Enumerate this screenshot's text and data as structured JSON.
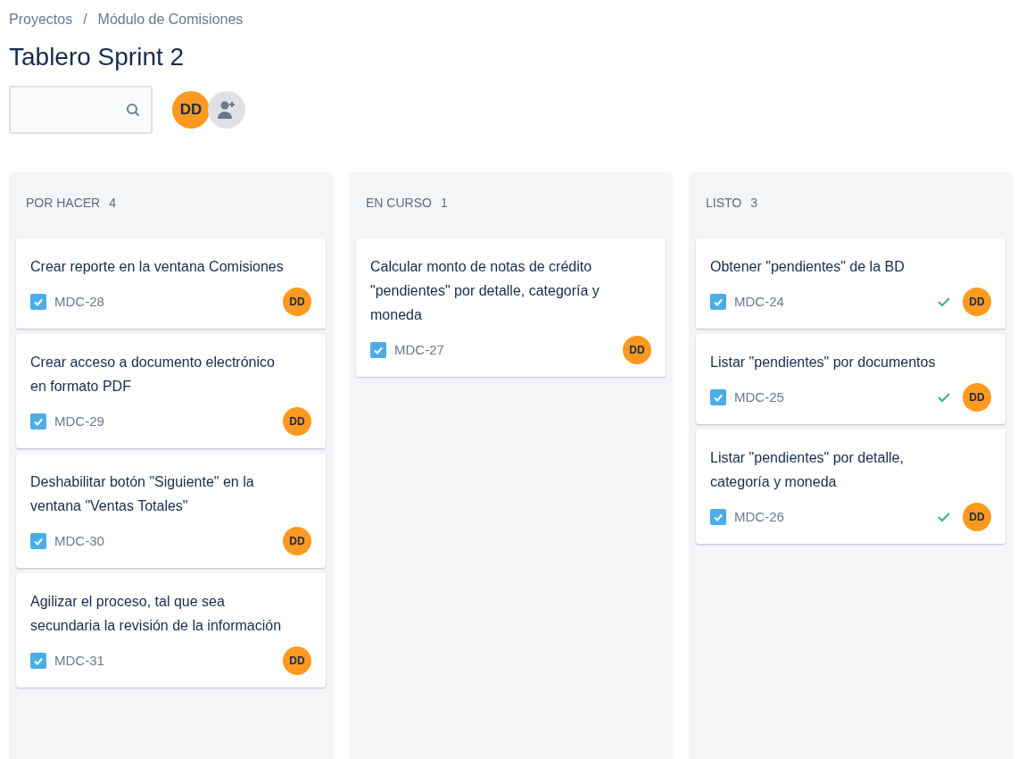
{
  "breadcrumb": [
    "Proyectos",
    "Módulo de Comisiones"
  ],
  "breadcrumb_separator": "/",
  "title": "Tablero Sprint 2",
  "members": [
    {
      "initials": "DD"
    }
  ],
  "columns": [
    {
      "name": "POR HACER",
      "count": "4",
      "cards": [
        {
          "title": "Crear reporte en la ventana Comisiones",
          "key": "MDC-28",
          "assignee": "DD",
          "done": false
        },
        {
          "title": "Crear acceso a documento electrónico en formato PDF",
          "key": "MDC-29",
          "assignee": "DD",
          "done": false
        },
        {
          "title": "Deshabilitar botón \"Siguiente\" en la ventana \"Ventas Totales\"",
          "key": "MDC-30",
          "assignee": "DD",
          "done": false
        },
        {
          "title": "Agilizar el proceso, tal que sea secundaria la revisión de la información",
          "key": "MDC-31",
          "assignee": "DD",
          "done": false
        }
      ]
    },
    {
      "name": "EN CURSO",
      "count": "1",
      "cards": [
        {
          "title": "Calcular monto de notas de crédito \"pendientes\" por detalle, categoría y moneda",
          "key": "MDC-27",
          "assignee": "DD",
          "done": false
        }
      ]
    },
    {
      "name": "LISTO",
      "count": "3",
      "cards": [
        {
          "title": "Obtener \"pendientes\" de la BD",
          "key": "MDC-24",
          "assignee": "DD",
          "done": true
        },
        {
          "title": "Listar \"pendientes\" por documentos",
          "key": "MDC-25",
          "assignee": "DD",
          "done": true
        },
        {
          "title": "Listar \"pendientes\" por detalle, categoría y moneda",
          "key": "MDC-26",
          "assignee": "DD",
          "done": true
        }
      ]
    }
  ]
}
